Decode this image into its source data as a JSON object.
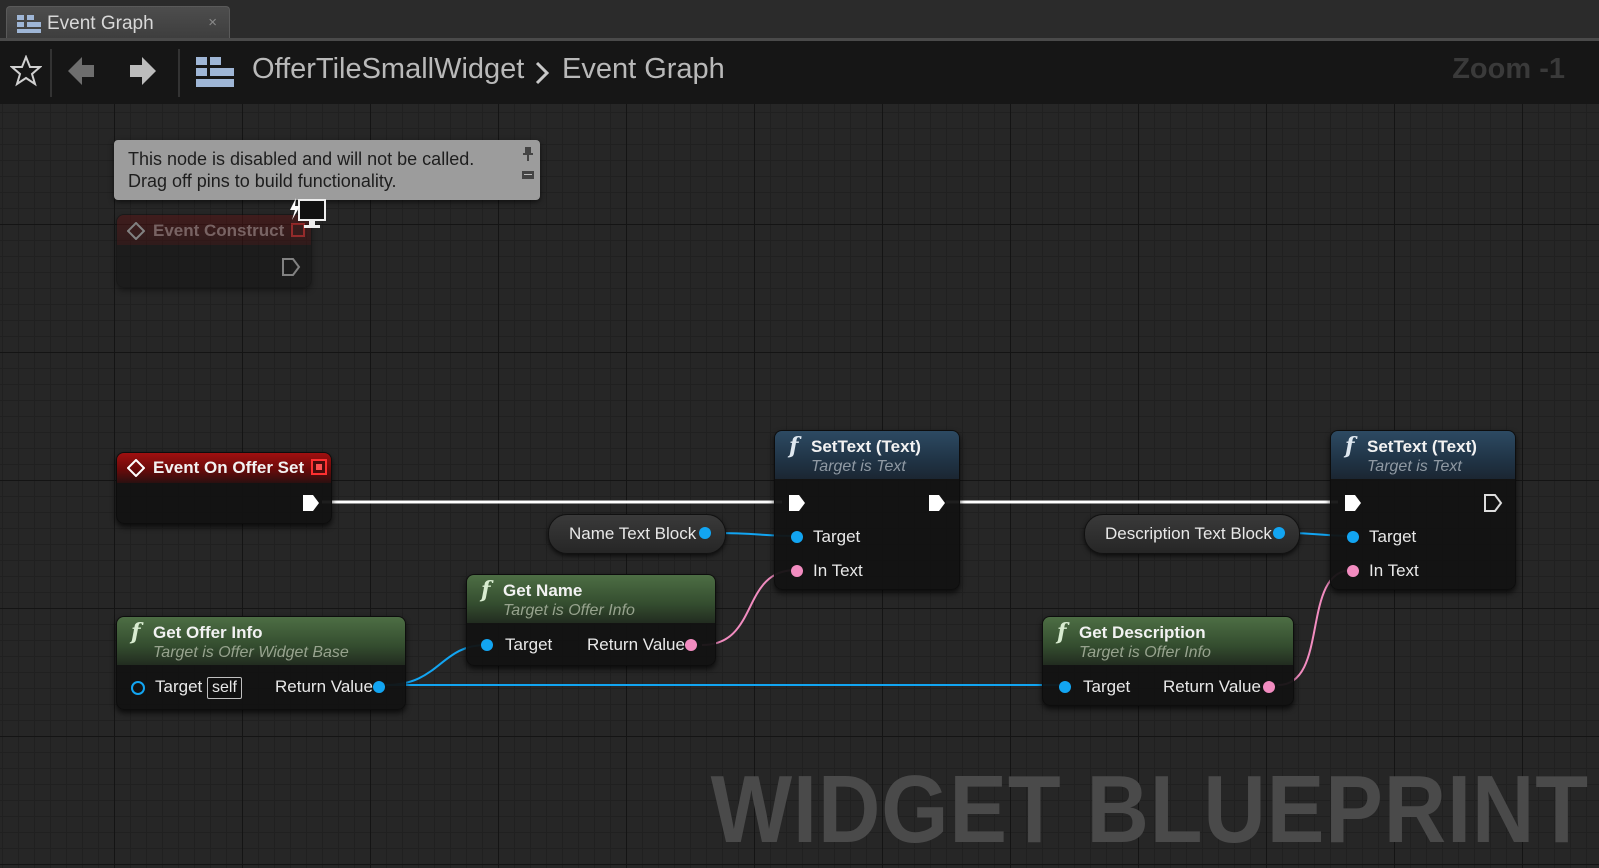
{
  "tab": {
    "title": "Event Graph",
    "close": "×"
  },
  "toolbar": {
    "breadcrumb": [
      "OfferTileSmallWidget",
      "Event Graph"
    ],
    "zoom": "Zoom -1"
  },
  "comment": {
    "line1": "This node is disabled and will not be called.",
    "line2": "Drag off pins to build functionality."
  },
  "nodes": {
    "event_construct": {
      "title": "Event Construct"
    },
    "event_offer_set": {
      "title": "Event On Offer Set"
    },
    "settext1": {
      "title": "SetText (Text)",
      "subtitle": "Target is Text",
      "pin_target": "Target",
      "pin_in": "In Text"
    },
    "settext2": {
      "title": "SetText (Text)",
      "subtitle": "Target is Text",
      "pin_target": "Target",
      "pin_in": "In Text"
    },
    "var_name": {
      "label": "Name Text Block"
    },
    "var_desc": {
      "label": "Description Text Block"
    },
    "get_name": {
      "title": "Get Name",
      "subtitle": "Target is Offer Info",
      "pin_target": "Target",
      "pin_return": "Return Value"
    },
    "get_offer_info": {
      "title": "Get Offer Info",
      "subtitle": "Target is Offer Widget Base",
      "pin_target": "Target",
      "self": "self",
      "pin_return": "Return Value"
    },
    "get_desc": {
      "title": "Get Description",
      "subtitle": "Target is Offer Info",
      "pin_target": "Target",
      "pin_return": "Return Value"
    }
  },
  "watermark": "WIDGET BLUEPRINT",
  "colors": {
    "object_pin": "#12a5f2",
    "text_pin": "#f28cc0",
    "exec": "#ffffff",
    "event_header": "#a01010",
    "function_header": "#2d4a63",
    "pure_header": "#4d6e44"
  }
}
